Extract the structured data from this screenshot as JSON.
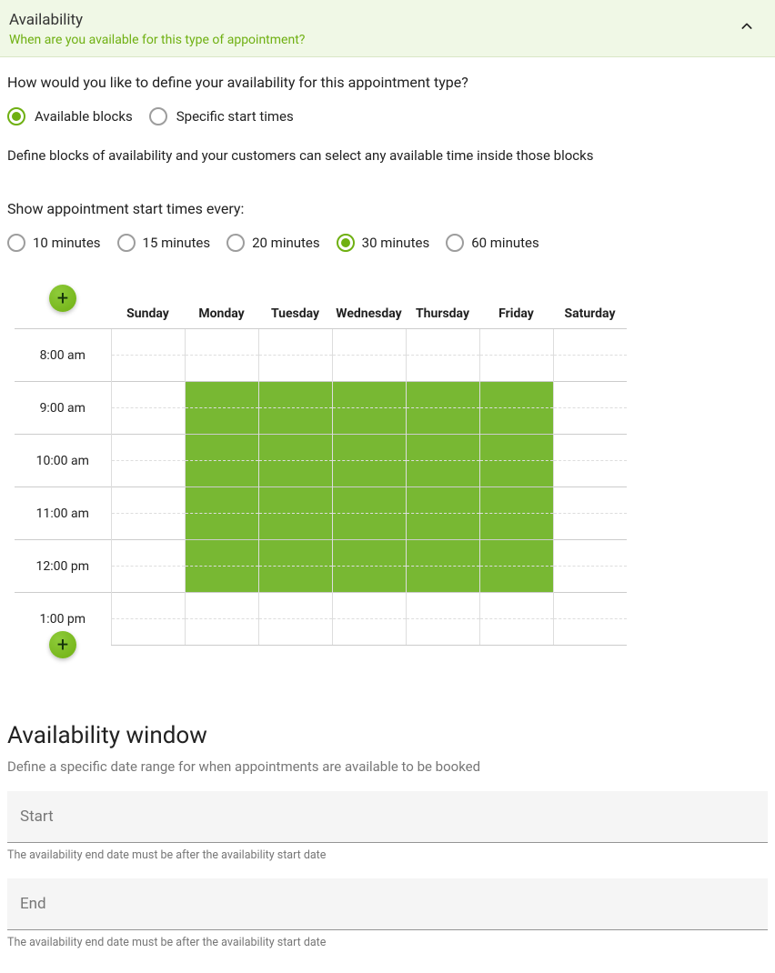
{
  "header": {
    "title": "Availability",
    "subtitle": "When are you available for this type of appointment?"
  },
  "defineQuestion": "How would you like to define your availability for this appointment type?",
  "modeOptions": [
    {
      "label": "Available blocks",
      "selected": true
    },
    {
      "label": "Specific start times",
      "selected": false
    }
  ],
  "blocksDescription": "Define blocks of availability and your customers can select any available time inside those blocks",
  "intervalLabel": "Show appointment start times every:",
  "intervalOptions": [
    {
      "label": "10 minutes",
      "selected": false
    },
    {
      "label": "15 minutes",
      "selected": false
    },
    {
      "label": "20 minutes",
      "selected": false
    },
    {
      "label": "30 minutes",
      "selected": true
    },
    {
      "label": "60 minutes",
      "selected": false
    }
  ],
  "calendar": {
    "days": [
      "Sunday",
      "Monday",
      "Tuesday",
      "Wednesday",
      "Thursday",
      "Friday",
      "Saturday"
    ],
    "timeRows": [
      {
        "label": "8:00 am",
        "slots": [
          0,
          0,
          0,
          0,
          0,
          0,
          0
        ]
      },
      {
        "label": "",
        "slots": [
          0,
          0,
          0,
          0,
          0,
          0,
          0
        ]
      },
      {
        "label": "9:00 am",
        "slots": [
          0,
          1,
          1,
          1,
          1,
          1,
          0
        ]
      },
      {
        "label": "",
        "slots": [
          0,
          1,
          1,
          1,
          1,
          1,
          0
        ]
      },
      {
        "label": "10:00 am",
        "slots": [
          0,
          1,
          1,
          1,
          1,
          1,
          0
        ]
      },
      {
        "label": "",
        "slots": [
          0,
          1,
          1,
          1,
          1,
          1,
          0
        ]
      },
      {
        "label": "11:00 am",
        "slots": [
          0,
          1,
          1,
          1,
          1,
          1,
          0
        ]
      },
      {
        "label": "",
        "slots": [
          0,
          1,
          1,
          1,
          1,
          1,
          0
        ]
      },
      {
        "label": "12:00 pm",
        "slots": [
          0,
          1,
          1,
          1,
          1,
          1,
          0
        ]
      },
      {
        "label": "",
        "slots": [
          0,
          1,
          1,
          1,
          1,
          1,
          0
        ]
      },
      {
        "label": "1:00 pm",
        "slots": [
          0,
          0,
          0,
          0,
          0,
          0,
          0
        ]
      },
      {
        "label": "",
        "slots": [
          0,
          0,
          0,
          0,
          0,
          0,
          0
        ]
      }
    ]
  },
  "addIcon": "+",
  "window": {
    "heading": "Availability window",
    "description": "Define a specific date range for when appointments are available to be booked",
    "startLabel": "Start",
    "endLabel": "End",
    "hint": "The availability end date must be after the availability start date"
  }
}
